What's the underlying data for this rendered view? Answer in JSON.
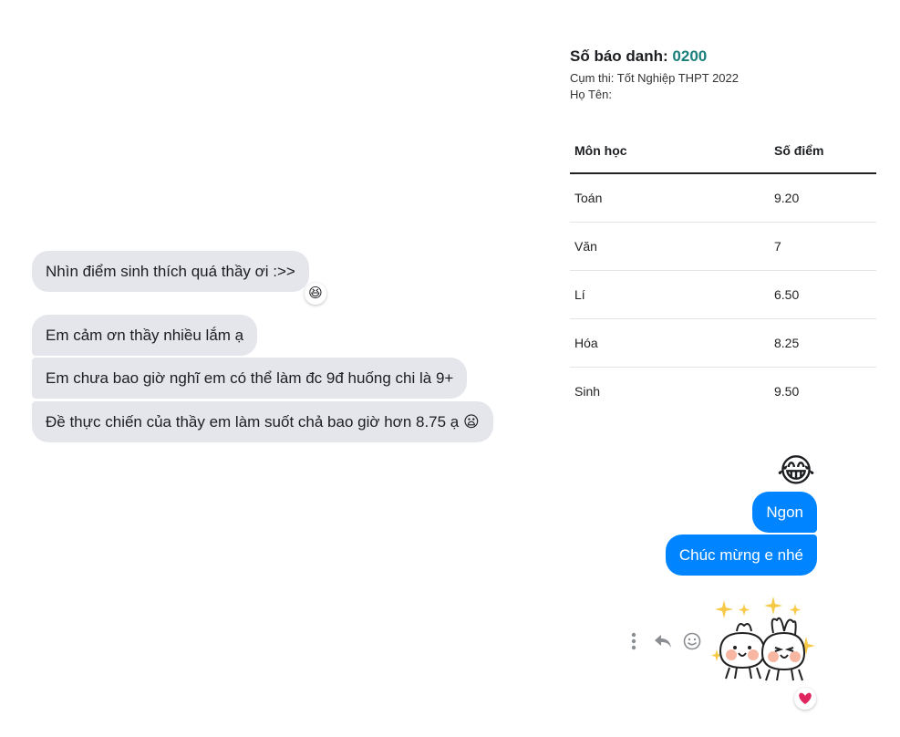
{
  "score_card": {
    "sbd_label": "Số báo danh:",
    "sbd_value": "0200",
    "cluster": "Cụm thi: Tốt Nghiệp THPT 2022",
    "name_label": "Họ Tên:",
    "columns": [
      "Môn học",
      "Số điểm"
    ],
    "rows": [
      {
        "subject": "Toán",
        "score": "9.20"
      },
      {
        "subject": "Văn",
        "score": "7"
      },
      {
        "subject": "Lí",
        "score": "6.50"
      },
      {
        "subject": "Hóa",
        "score": "8.25"
      },
      {
        "subject": "Sinh",
        "score": "9.50"
      }
    ]
  },
  "received": [
    {
      "text": "Nhìn điểm sinh thích quá thầy ơi :>>",
      "reaction": "😆"
    },
    {
      "text": "Em cảm ơn thầy nhiều lắm ạ"
    },
    {
      "text": "Em chưa bao giờ nghĩ em có thể làm đc 9đ huống chi là 9+"
    },
    {
      "text": "Đề thực chiến của thầy em làm suốt chả bao giờ hơn 8.75 ạ",
      "emoji": "😦"
    }
  ],
  "sent": {
    "emoji": "😂",
    "messages": [
      "Ngon",
      "Chúc mừng e nhé"
    ],
    "sticker_reaction": "heart",
    "sticker_reaction_color": "#e0245e"
  },
  "actions": [
    "more-icon",
    "reply-icon",
    "react-icon"
  ],
  "colors": {
    "sent_bubble": "#0084ff",
    "received_bubble": "#e4e6eb",
    "sbd_accent": "#1a7f7a"
  }
}
